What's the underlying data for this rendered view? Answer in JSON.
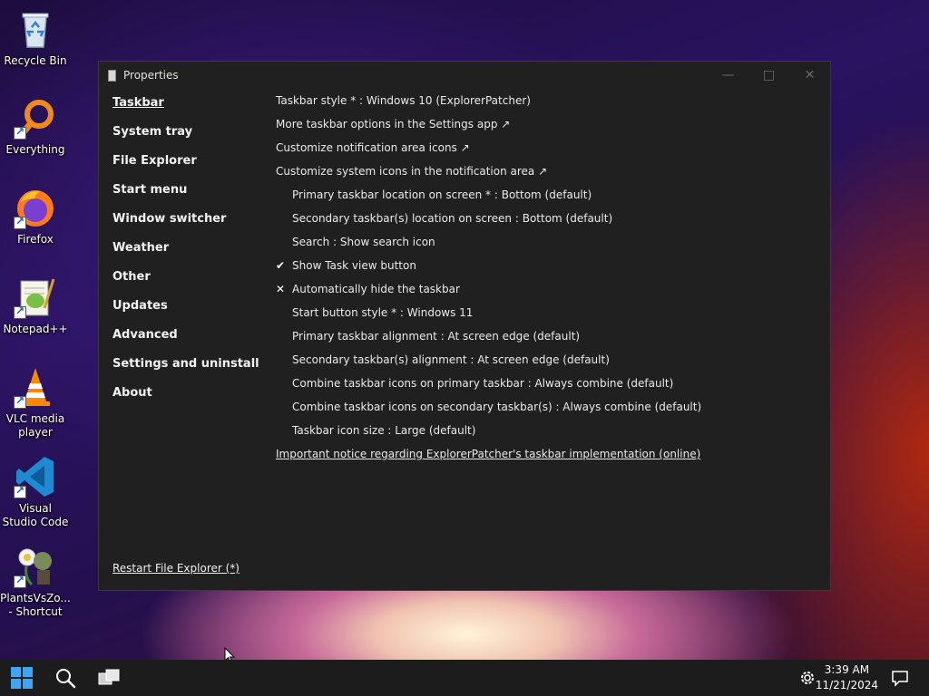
{
  "desktop": {
    "icons": [
      {
        "label": "Recycle Bin",
        "icon": "recycle-bin-icon"
      },
      {
        "label": "Everything",
        "icon": "everything-search-icon"
      },
      {
        "label": "Firefox",
        "icon": "firefox-icon"
      },
      {
        "label": "Notepad++",
        "icon": "notepad-plus-plus-icon"
      },
      {
        "label": "VLC media player",
        "icon": "vlc-icon"
      },
      {
        "label": "Visual Studio Code",
        "icon": "vscode-icon"
      },
      {
        "label": "PlantsVsZo... - Shortcut",
        "icon": "plants-vs-zombies-icon"
      }
    ]
  },
  "window": {
    "title": "Properties",
    "controls": {
      "minimize": "—",
      "maximize": "□",
      "close": "✕"
    },
    "sidebar": {
      "items": [
        {
          "label": "Taskbar",
          "active": true
        },
        {
          "label": "System tray"
        },
        {
          "label": "File Explorer"
        },
        {
          "label": "Start menu"
        },
        {
          "label": "Window switcher"
        },
        {
          "label": "Weather"
        },
        {
          "label": "Other"
        },
        {
          "label": "Updates"
        },
        {
          "label": "Advanced"
        },
        {
          "label": "Settings and uninstall"
        },
        {
          "label": "About"
        }
      ],
      "restart_label": "Restart File Explorer (*)"
    },
    "options": [
      {
        "label": "Taskbar style * : Windows 10 (ExplorerPatcher)"
      },
      {
        "label": "More taskbar options in the Settings app ↗"
      },
      {
        "label": "Customize notification area icons ↗"
      },
      {
        "label": "Customize system icons in the notification area ↗"
      },
      {
        "label": "Primary taskbar location on screen * : Bottom (default)"
      },
      {
        "label": "Secondary taskbar(s) location on screen : Bottom (default)"
      },
      {
        "label": "Search : Show search icon"
      },
      {
        "label": "Show Task view button",
        "mark": "✔"
      },
      {
        "label": "Automatically hide the taskbar",
        "mark": "✕"
      },
      {
        "label": "Start button style * : Windows 11"
      },
      {
        "label": "Primary taskbar alignment : At screen edge (default)"
      },
      {
        "label": "Secondary taskbar(s) alignment : At screen edge (default)"
      },
      {
        "label": "Combine taskbar icons on primary taskbar : Always combine (default)"
      },
      {
        "label": "Combine taskbar icons on secondary taskbar(s) : Always combine (default)"
      },
      {
        "label": "Taskbar icon size : Large (default)"
      },
      {
        "label": "Important notice regarding ExplorerPatcher's taskbar implementation (online)"
      }
    ]
  },
  "taskbar": {
    "start_icon": "windows-start-icon",
    "search_icon": "search-icon",
    "taskview_icon": "task-view-icon",
    "tray_icon": "settings-gear-icon",
    "time": "3:39 AM",
    "date": "11/21/2024",
    "notification_icon": "notification-icon"
  },
  "colors": {
    "window_bg": "#202020",
    "taskbar_bg": "#1c1c1c",
    "accent": "#3ea6f5"
  }
}
